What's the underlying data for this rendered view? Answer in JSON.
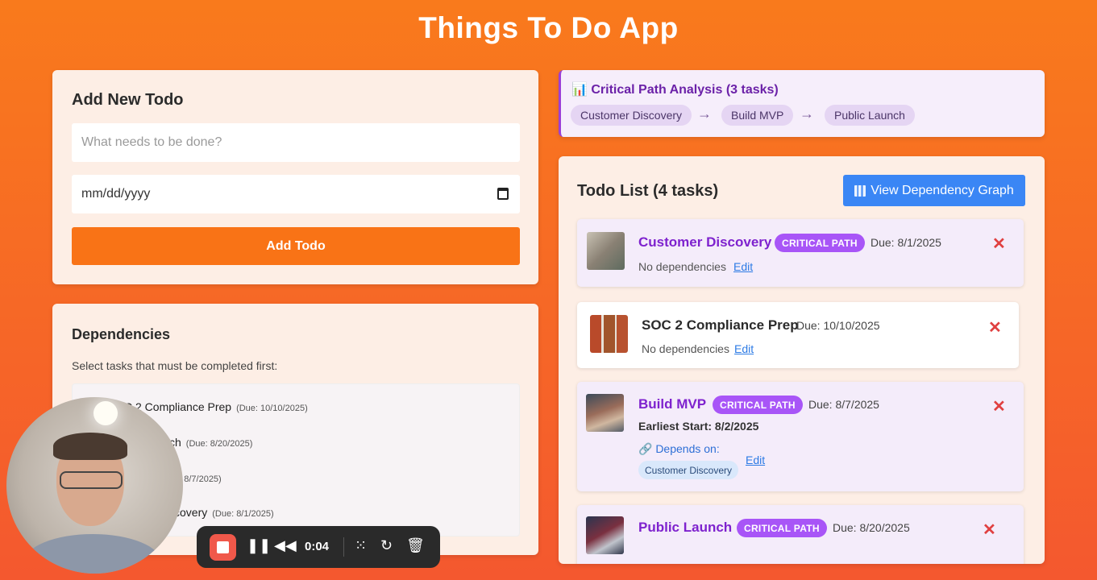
{
  "app": {
    "title": "Things To Do App"
  },
  "add_todo": {
    "heading": "Add New Todo",
    "task_placeholder": "What needs to be done?",
    "date_placeholder": "mm/dd/yyyy",
    "add_button": "Add Todo"
  },
  "dependencies": {
    "heading": "Dependencies",
    "hint": "Select tasks that must be completed first:",
    "items": [
      {
        "label": "C 2 Compliance Prep",
        "due": "(Due: 10/10/2025)"
      },
      {
        "label": "ch",
        "due": "(Due: 8/20/2025)"
      },
      {
        "label": "",
        "due": "e: 8/7/2025)"
      },
      {
        "label": "covery",
        "due": "(Due: 8/1/2025)"
      }
    ]
  },
  "critical_path": {
    "title": "📊 Critical Path Analysis (3 tasks)",
    "steps": [
      "Customer Discovery",
      "Build MVP",
      "Public Launch"
    ],
    "arrow": "→"
  },
  "todo_list": {
    "heading": "Todo List (4 tasks)",
    "graph_button": "View Dependency Graph",
    "items": [
      {
        "name": "Customer Discovery",
        "badge": "CRITICAL PATH",
        "due": "Due: 8/1/2025",
        "deps": "No dependencies",
        "edit": "Edit"
      },
      {
        "name": "SOC 2 Compliance Prep",
        "due": "Due: 10/10/2025",
        "deps": "No dependencies",
        "edit": "Edit"
      },
      {
        "name": "Build MVP",
        "badge": "CRITICAL PATH",
        "due": "Due: 8/7/2025",
        "earliest": "Earliest Start: 8/2/2025",
        "depends_label": "🔗 Depends on:",
        "depends_chip": "Customer Discovery",
        "edit": "Edit"
      },
      {
        "name": "Public Launch",
        "badge": "CRITICAL PATH",
        "due": "Due: 8/20/2025"
      }
    ],
    "close_symbol": "✕"
  },
  "recorder": {
    "time": "0:04",
    "icons": [
      "stop-icon",
      "pause-icon",
      "rewind-icon",
      "grid-icon",
      "restart-icon",
      "trash-icon"
    ]
  },
  "colors": {
    "accent": "#f97316",
    "critical": "#a855f7",
    "link": "#2d7be5",
    "graph_button": "#3a86f5"
  }
}
